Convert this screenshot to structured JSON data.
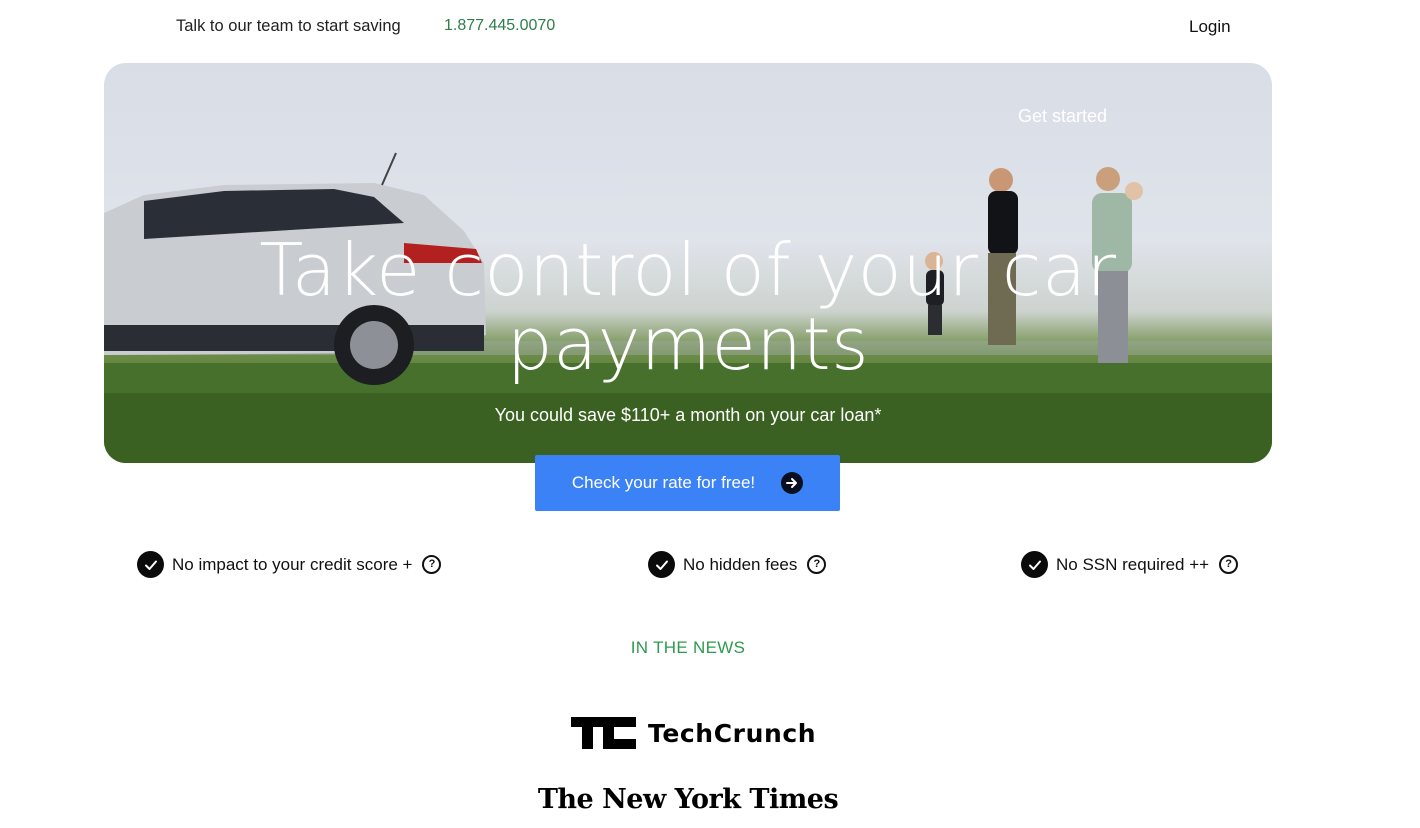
{
  "header": {
    "tagline": "Talk to our team to start saving",
    "phone": "1.877.445.0070",
    "login_label": "Login"
  },
  "hero": {
    "get_started_label": "Get started",
    "title_line1": "Take control of your car",
    "title_line2": "payments",
    "subtitle": "You could save $110+ a month on your car loan*"
  },
  "cta": {
    "label": "Check your rate for free!",
    "icon": "arrow-right-circle-icon"
  },
  "features": [
    {
      "label": "No impact to your credit score +",
      "icon": "check-circle-icon",
      "help_icon": "question-circle-icon"
    },
    {
      "label": "No hidden fees",
      "icon": "check-circle-icon",
      "help_icon": "question-circle-icon"
    },
    {
      "label": "No SSN required ++",
      "icon": "check-circle-icon",
      "help_icon": "question-circle-icon"
    }
  ],
  "news": {
    "heading": "IN THE NEWS",
    "logos": [
      {
        "name": "TechCrunch",
        "text": "TechCrunch"
      },
      {
        "name": "The New York Times",
        "text": "The New York Times"
      }
    ]
  },
  "colors": {
    "accent": "#3b82f6",
    "phone": "#2e7d4a",
    "news_heading": "#2e9a4d"
  }
}
